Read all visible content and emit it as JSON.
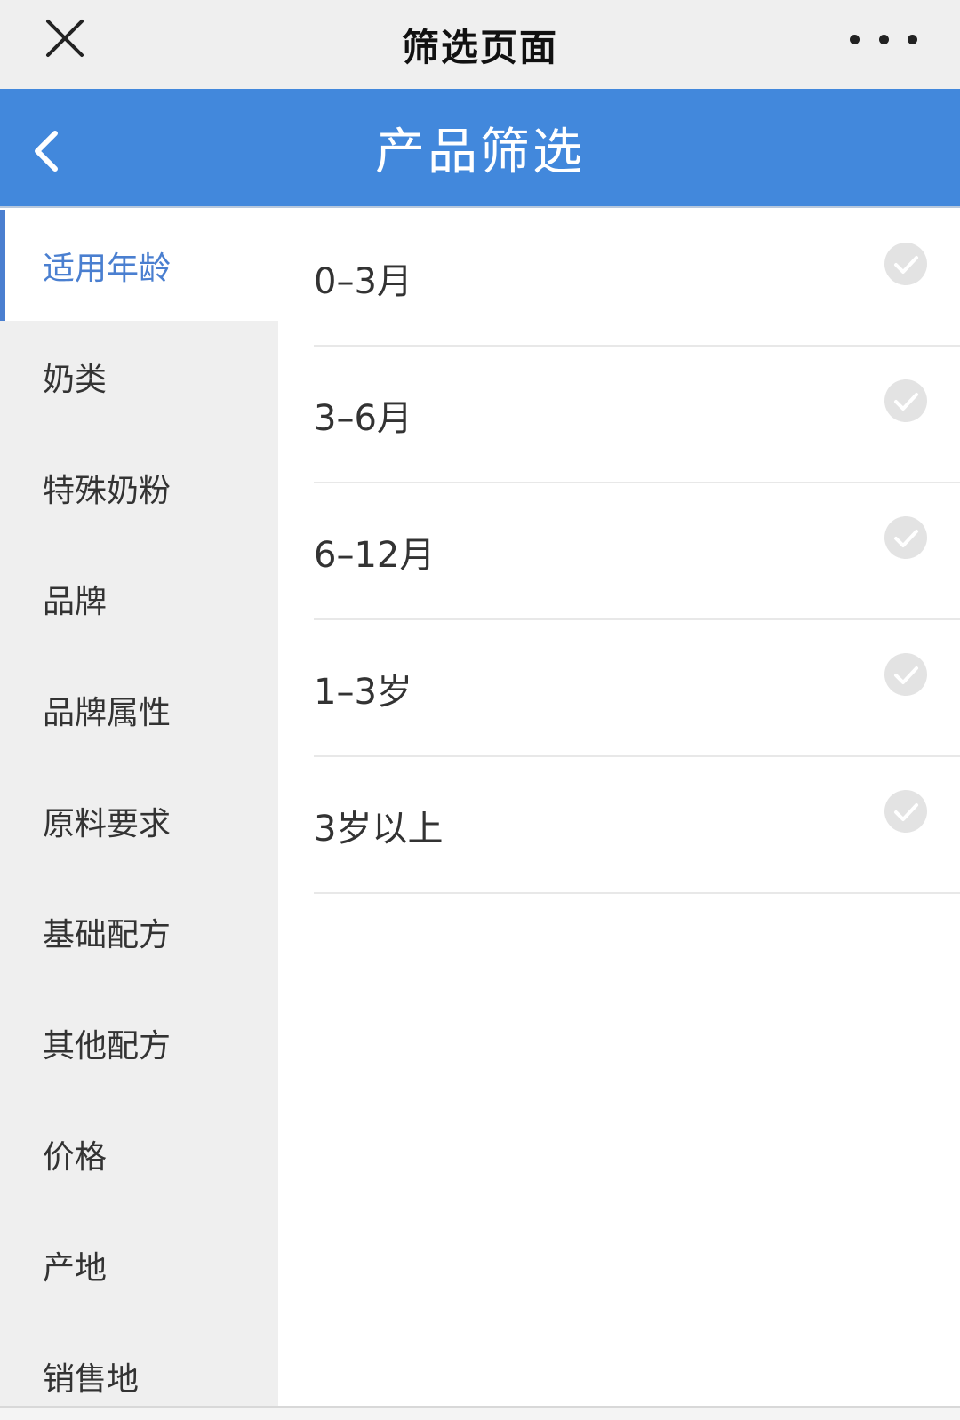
{
  "topbar": {
    "title": "筛选页面"
  },
  "header": {
    "title": "产品筛选"
  },
  "sidebar": {
    "items": [
      {
        "label": "适用年龄",
        "active": true
      },
      {
        "label": "奶类"
      },
      {
        "label": "特殊奶粉"
      },
      {
        "label": "品牌"
      },
      {
        "label": "品牌属性"
      },
      {
        "label": "原料要求"
      },
      {
        "label": "基础配方"
      },
      {
        "label": "其他配方"
      },
      {
        "label": "价格"
      },
      {
        "label": "产地"
      },
      {
        "label": "销售地"
      }
    ]
  },
  "options": [
    {
      "label": "0–3月",
      "checked": false
    },
    {
      "label": "3–6月",
      "checked": false
    },
    {
      "label": "6–12月",
      "checked": false
    },
    {
      "label": "1–3岁",
      "checked": false
    },
    {
      "label": "3岁以上",
      "checked": false
    }
  ],
  "colors": {
    "header_bg": "#4288dc",
    "accent": "#4a7fd0",
    "sidebar_bg": "#efefef",
    "check_inactive": "#e3e3e3"
  }
}
